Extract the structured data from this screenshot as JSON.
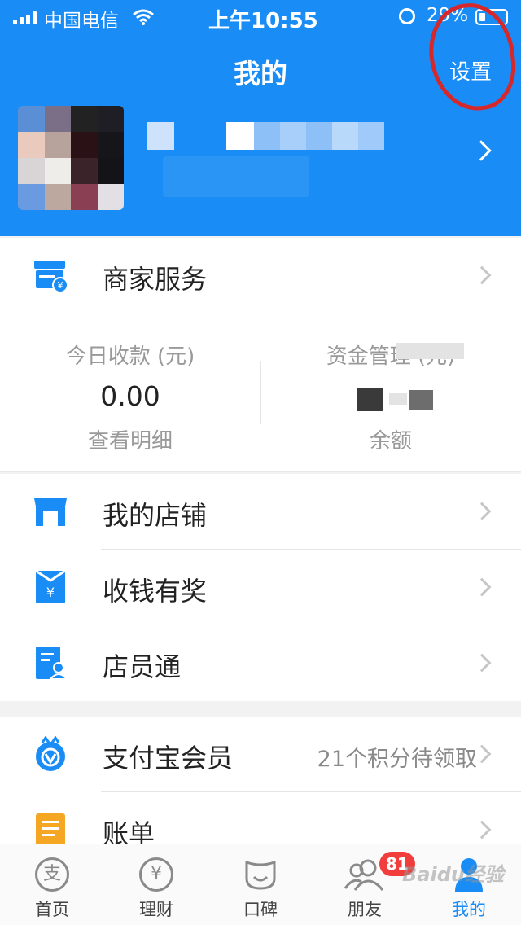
{
  "status_bar": {
    "carrier": "中国电信",
    "time": "上午10:55",
    "battery": "29%"
  },
  "header": {
    "title": "我的",
    "settings_label": "设置"
  },
  "merchant_row": {
    "label": "商家服务",
    "icon": "merchant-store-icon"
  },
  "stats": {
    "today": {
      "caption": "今日收款 (元)",
      "value": "0.00",
      "link": "查看明细"
    },
    "funds": {
      "caption": "资金管理 (元)",
      "link": "余额"
    }
  },
  "menu_group_1": [
    {
      "label": "我的店铺",
      "icon": "shop-icon"
    },
    {
      "label": "收钱有奖",
      "icon": "red-packet-icon"
    },
    {
      "label": "店员通",
      "icon": "staff-doc-icon"
    }
  ],
  "menu_group_2": [
    {
      "label": "支付宝会员",
      "icon": "member-badge-icon",
      "extra": "21个积分待领取"
    },
    {
      "label": "账单",
      "icon": "bill-icon"
    }
  ],
  "tabbar": {
    "items": [
      {
        "label": "首页",
        "icon": "zhi-home-icon",
        "glyph": "支"
      },
      {
        "label": "理财",
        "icon": "yuan-finance-icon",
        "glyph": "¥"
      },
      {
        "label": "口碑",
        "icon": "koubei-smile-icon",
        "glyph": ""
      },
      {
        "label": "朋友",
        "icon": "friends-icon",
        "glyph": ""
      },
      {
        "label": "我的",
        "icon": "me-person-icon",
        "glyph": ""
      }
    ],
    "friends_badge": "81"
  },
  "watermark": "Baidu经验",
  "colors": {
    "brand_blue": "#1a8cf5",
    "annotation_red": "#d6282b",
    "badge_red": "#f23d3d"
  }
}
